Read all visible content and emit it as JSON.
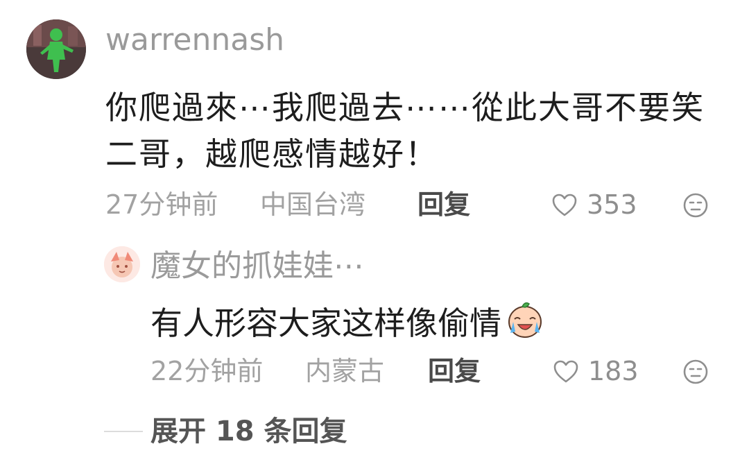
{
  "comment": {
    "username": "warrennash",
    "text": "你爬過來⋯我爬過去⋯⋯從此大哥不要笑二哥，越爬感情越好！",
    "time": "27分钟前",
    "location": "中国台湾",
    "reply_label": "回复",
    "likes": "353",
    "reaction_icon": "neutral-face-icon"
  },
  "reply": {
    "username": "魔女的抓娃娃⋯",
    "text": "有人形容大家这样像偷情",
    "emoji": "crying-laughing-emoji",
    "time": "22分钟前",
    "location": "内蒙古",
    "reply_label": "回复",
    "likes": "183",
    "reaction_icon": "neutral-face-icon"
  },
  "expand": {
    "label": "展开 18 条回复"
  },
  "colors": {
    "primary_text": "#1d1d1d",
    "secondary_text": "#a2a2a2",
    "avatar_green": "#3fbf4f"
  }
}
